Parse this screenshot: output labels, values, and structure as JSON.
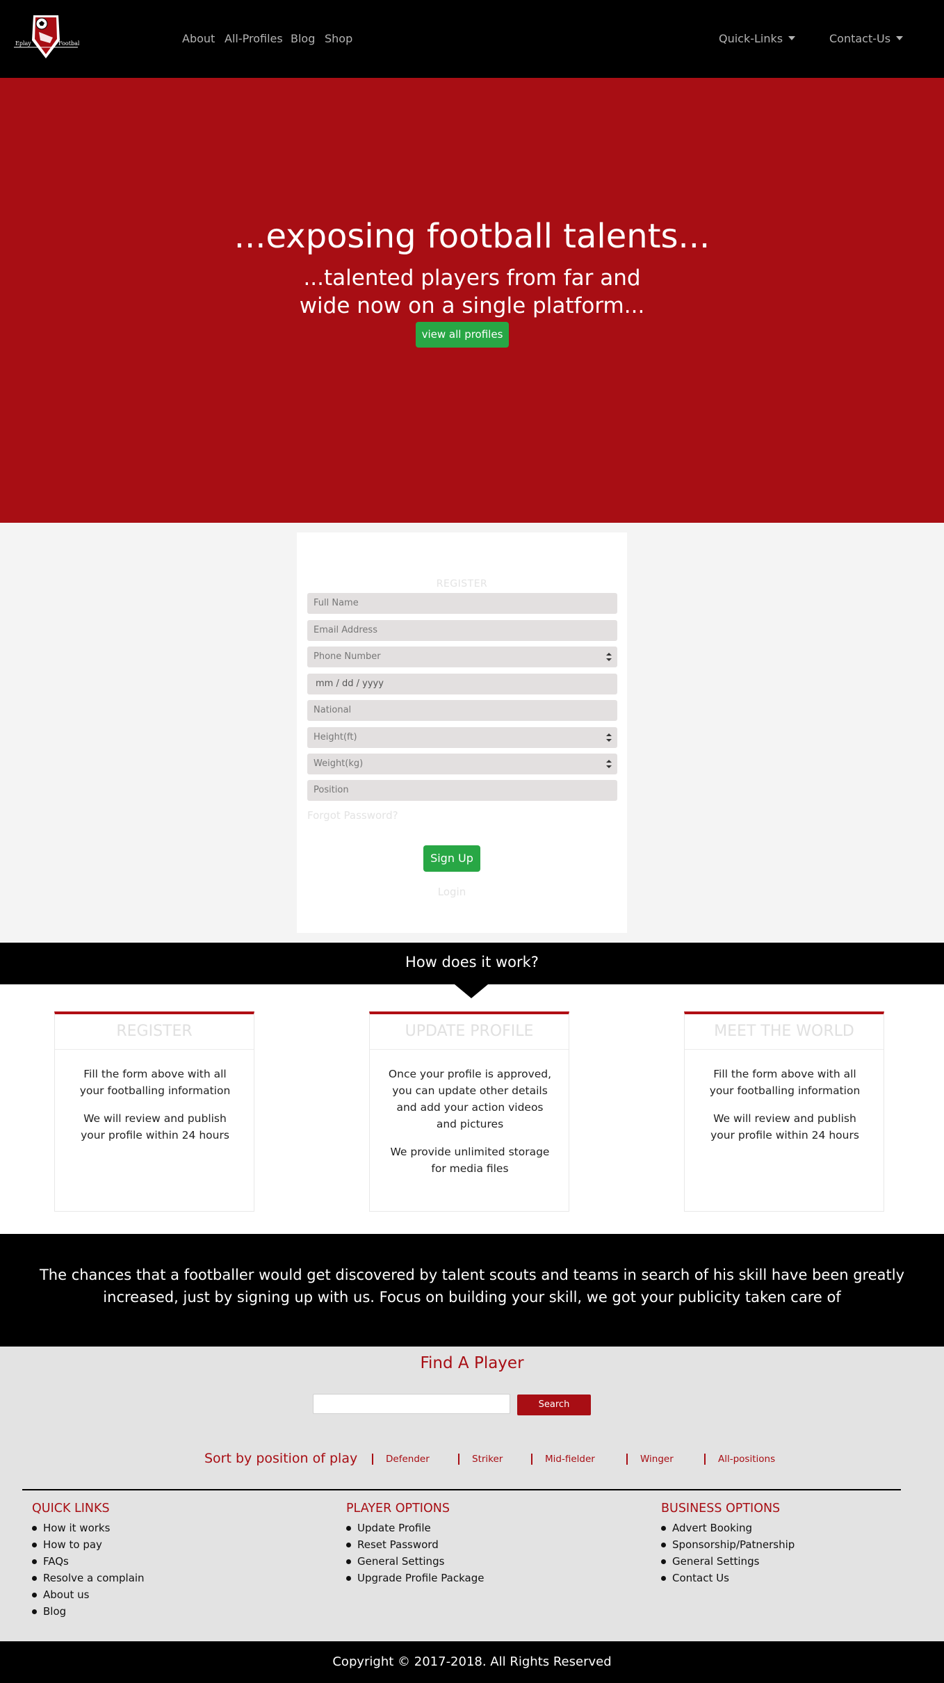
{
  "nav": {
    "logo_left_text": "Eplay",
    "logo_right_text": "Football",
    "links": [
      "About",
      "All-Profiles",
      "Blog",
      "Shop"
    ],
    "dropdowns": [
      "Quick-Links",
      "Contact-Us"
    ]
  },
  "hero": {
    "title": "...exposing football talents...",
    "subtitle": "...talented players from far and wide now on a single platform...",
    "button": "view all profiles",
    "bg_color": "#a80e14"
  },
  "register": {
    "title": "REGISTER",
    "fields": [
      {
        "placeholder": "Full Name",
        "type": "text"
      },
      {
        "placeholder": "Email Address",
        "type": "text"
      },
      {
        "placeholder": "Phone Number",
        "type": "number"
      },
      {
        "placeholder": "mm / dd / yyyy",
        "type": "date"
      },
      {
        "placeholder": "National",
        "type": "text"
      },
      {
        "placeholder": "Height(ft)",
        "type": "number"
      },
      {
        "placeholder": "Weight(kg)",
        "type": "number"
      },
      {
        "placeholder": "Position",
        "type": "text"
      }
    ],
    "forgot": "Forgot Password?",
    "signup": "Sign Up",
    "login": "Login"
  },
  "how": {
    "heading": "How does it work?",
    "steps": [
      {
        "title": "REGISTER",
        "paragraphs": [
          "Fill the form above with all your footballing information",
          "We will review and publish your profile within 24 hours"
        ]
      },
      {
        "title": "UPDATE PROFILE",
        "paragraphs": [
          "Once your profile is approved, you can update other details and add your action videos and pictures",
          "We provide unlimited storage for media files"
        ]
      },
      {
        "title": "MEET THE WORLD",
        "paragraphs": [
          "Fill the form above with all your footballing information",
          "We will review and publish your profile within 24 hours"
        ]
      }
    ]
  },
  "quote": "The chances that a footballer would get discovered by talent scouts and teams in search of his skill have been greatly increased, just by signing up with us. Focus on building your skill, we got your publicity taken care of",
  "find": {
    "title": "Find A Player",
    "search_value": "",
    "search_button": "Search",
    "sort_label": "Sort by position of play",
    "sort_options": [
      "Defender",
      "Striker",
      "Mid-fielder",
      "Winger",
      "All-positions"
    ]
  },
  "footer": {
    "columns": [
      {
        "title": "QUICK LINKS",
        "items": [
          "How it works",
          "How to pay",
          "FAQs",
          "Resolve a complain",
          "About us",
          "Blog"
        ]
      },
      {
        "title": "PLAYER OPTIONS",
        "items": [
          "Update Profile",
          "Reset Password",
          "General Settings",
          "Upgrade Profile Package"
        ]
      },
      {
        "title": "BUSINESS OPTIONS",
        "items": [
          "Advert Booking",
          "Sponsorship/Patnership",
          "General Settings",
          "Contact Us"
        ]
      }
    ],
    "copyright": "Copyright © 2017-2018. All Rights Reserved"
  }
}
